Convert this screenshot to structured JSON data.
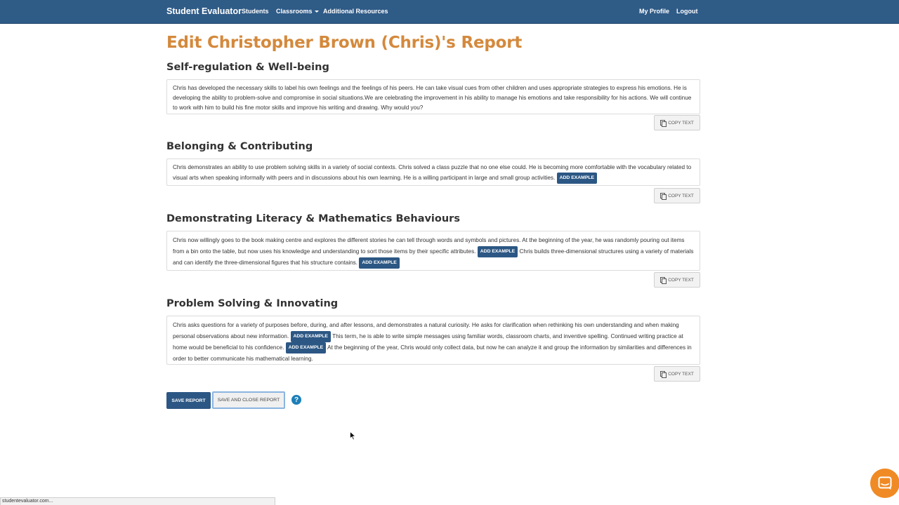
{
  "navbar": {
    "brand": "Student Evaluator",
    "links": {
      "students": "Students",
      "classrooms": "Classrooms",
      "additional_resources": "Additional Resources",
      "my_profile": "My Profile",
      "logout": "Logout"
    }
  },
  "page_title": "Edit Christopher Brown (Chris)'s Report",
  "add_example_label": "ADD EXAMPLE",
  "copy_text_label": "COPY TEXT",
  "sections": [
    {
      "heading": "Self-regulation & Well-being",
      "parts": [
        "Chris has developed the necessary skills to label his own feelings and the feelings of his peers. He can take visual cues from other children and uses appropriate strategies to express his emotions. He is developing the ability to problem-solve and compromise in social situations.We are celebrating the improvement in his ability to manage his emotions and take responsibility for his actions. We will continue to work with him to build his fine motor skills and improve his writing and drawing. Why would you?"
      ]
    },
    {
      "heading": "Belonging & Contributing",
      "parts": [
        "Chris demonstrates an ability to use problem solving skills in a variety of social contexts. Chris solved a class puzzle that no one else could. He is becoming more comfortable with the vocabulary related to visual arts when speaking informally with peers and in discussions about his own learning. He is a willing participant in large and small group activities."
      ]
    },
    {
      "heading": "Demonstrating Literacy & Mathematics Behaviours",
      "parts": [
        "Chris now willingly goes to the book making centre and explores the different stories he can tell through words and symbols and pictures. At the beginning of the year, he was randomly pouring out items from a bin onto the table, but now uses his knowledge and understanding to sort those items by their specific attributes.",
        "Chris builds three-dimensional structures using a variety of materials and can identify the three-dimensional figures that his structure contains."
      ]
    },
    {
      "heading": "Problem Solving & Innovating",
      "parts": [
        "Chris asks questions for a variety of purposes before, during, and after lessons, and demonstrates a natural curiosity. He asks for clarification when rethinking his own understanding and when making personal observations about new information.",
        "This term, he is able to write simple messages using familiar words, classroom charts, and inventive spelling. Continued writing practice at home would be beneficial to his confidence.",
        "At the beginning of the year, Chris would only collect data, but now he can analyze it and group the information by similarities and differences in order to better communicate his mathematical learning."
      ]
    }
  ],
  "actions": {
    "save_report": "SAVE REPORT",
    "save_and_close": "SAVE AND CLOSE REPORT",
    "help": "?"
  },
  "status_bar": "studentevaluator.com..."
}
